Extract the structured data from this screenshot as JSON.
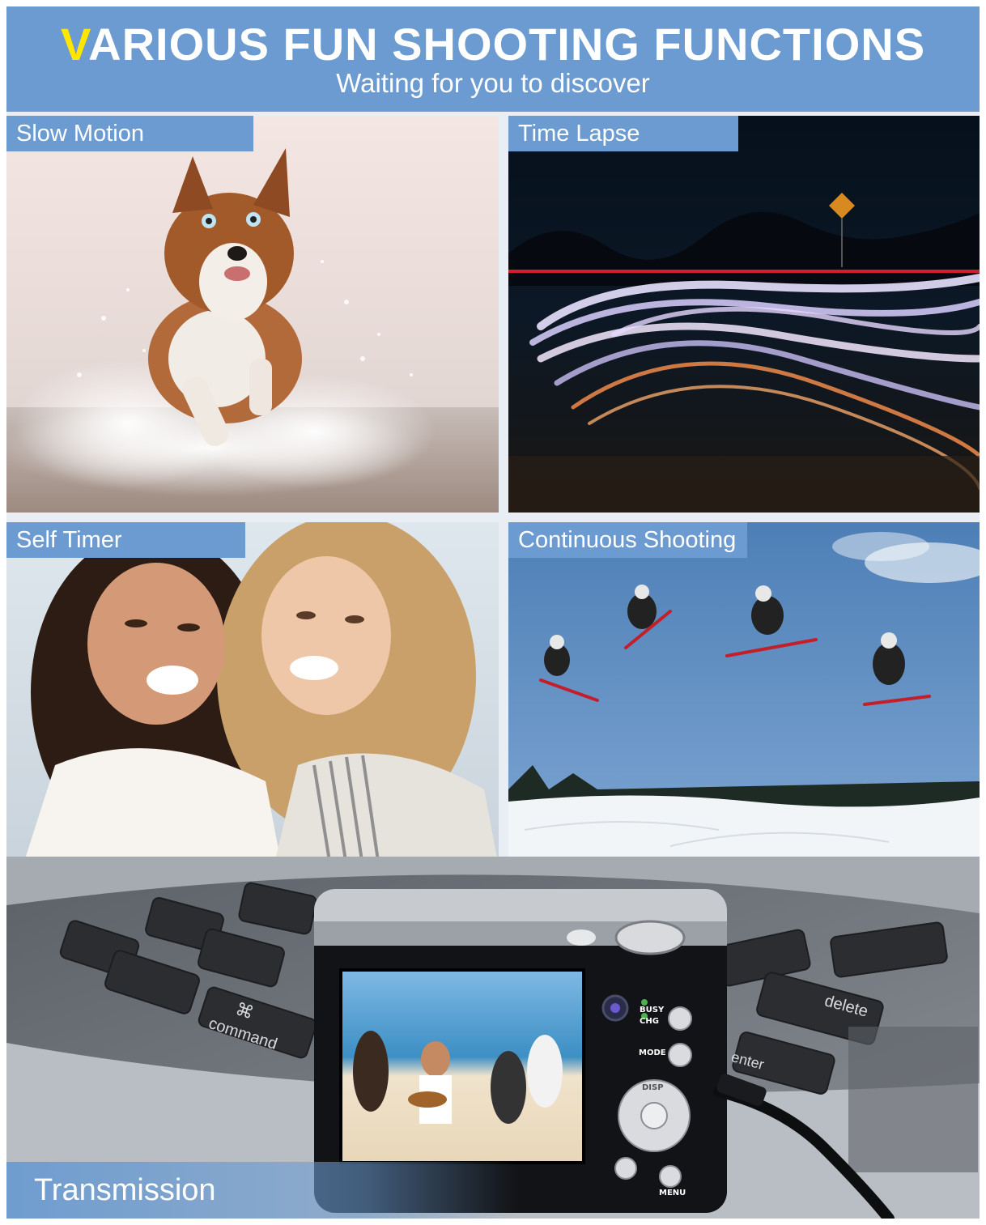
{
  "header": {
    "title_accent": "V",
    "title_rest": "ARIOUS FUN SHOOTING FUNCTIONS",
    "subtitle": "Waiting for you to discover"
  },
  "panels": {
    "slow_motion": "Slow Motion",
    "time_lapse": "Time Lapse",
    "self_timer": "Self Timer",
    "continuous_shooting": "Continuous Shooting",
    "transmission": "Transmission"
  },
  "camera": {
    "busy": "BUSY",
    "chg": "CHG",
    "mode": "MODE",
    "disp": "DISP",
    "menu": "MENU"
  },
  "keyboard": {
    "command": "command",
    "delete": "delete",
    "enter": "enter",
    "cmd_symbol": "⌘"
  },
  "colors": {
    "banner": "#6b9bd0",
    "accent": "#ffe600"
  }
}
